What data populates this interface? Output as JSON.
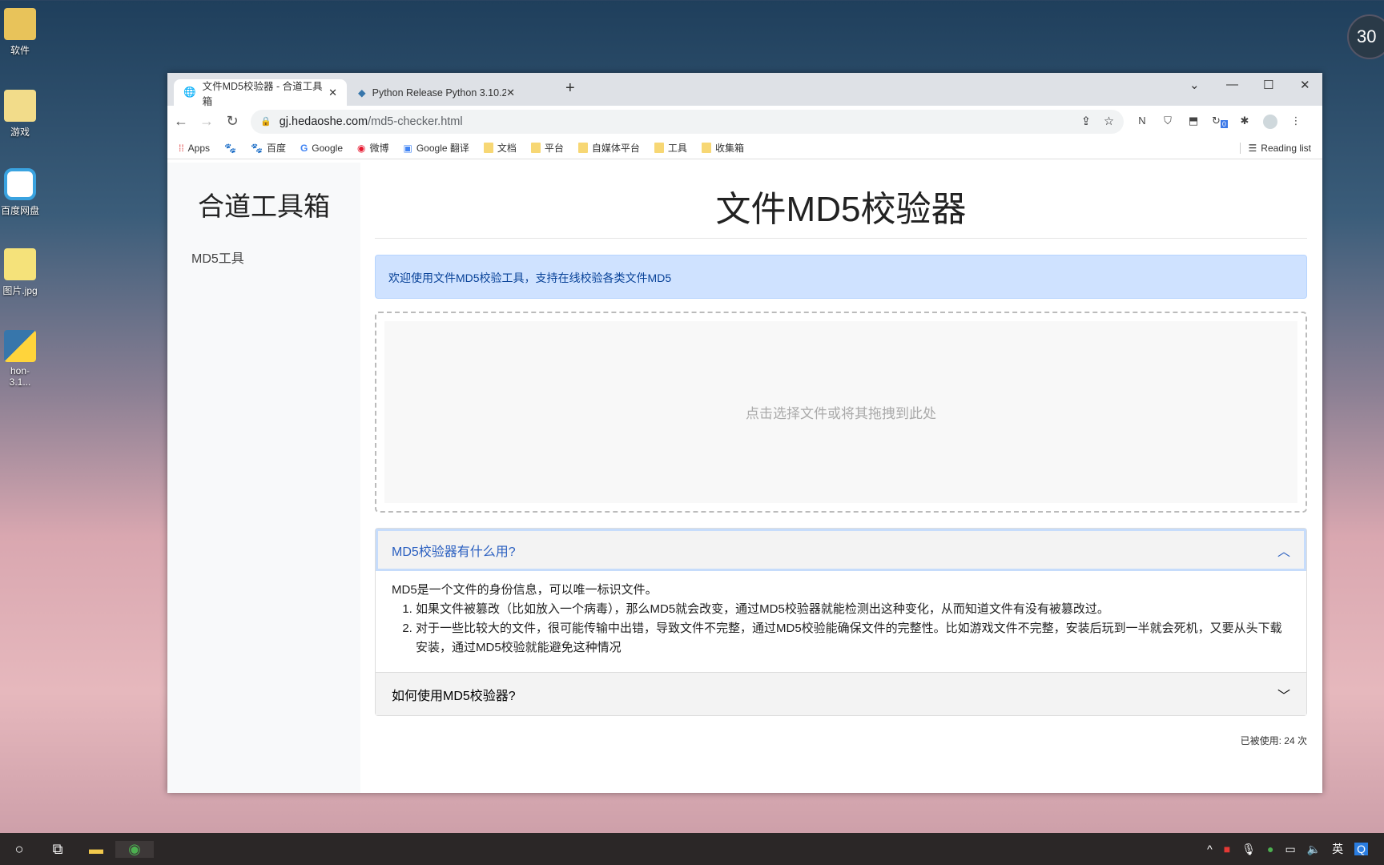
{
  "desktop": {
    "icons": [
      {
        "label": "软件"
      },
      {
        "label": "游戏"
      },
      {
        "label": "百度网盘"
      },
      {
        "label": "图片.jpg"
      },
      {
        "label": "hon-3.1..."
      }
    ],
    "clock_badge": "30"
  },
  "browser": {
    "tabs": [
      {
        "title": "文件MD5校验器 - 合道工具箱",
        "icon": "globe-icon"
      },
      {
        "title": "Python Release Python 3.10.2",
        "icon": "python-icon"
      }
    ],
    "url_host": "gj.hedaoshe.com",
    "url_path": "/md5-checker.html",
    "bookmarks": [
      {
        "label": "Apps",
        "icon": "apps-grid-icon"
      },
      {
        "label": "",
        "icon": "baidu-paw-icon"
      },
      {
        "label": "百度",
        "icon": "baidu-paw-icon"
      },
      {
        "label": "Google",
        "icon": "google-icon"
      },
      {
        "label": "微博",
        "icon": "weibo-icon"
      },
      {
        "label": "Google 翻译",
        "icon": "translate-icon"
      },
      {
        "label": "文档",
        "icon": "folder-icon"
      },
      {
        "label": "平台",
        "icon": "folder-icon"
      },
      {
        "label": "自媒体平台",
        "icon": "folder-icon"
      },
      {
        "label": "工具",
        "icon": "folder-icon"
      },
      {
        "label": "收集箱",
        "icon": "folder-icon"
      }
    ],
    "reading_list": "Reading list",
    "ext_badge": "0"
  },
  "page": {
    "brand": "合道工具箱",
    "nav": [
      "MD5工具"
    ],
    "title": "文件MD5校验器",
    "alert": "欢迎使用文件MD5校验工具，支持在线校验各类文件MD5",
    "dropzone": "点击选择文件或将其拖拽到此处",
    "faq": [
      {
        "q": "MD5校验器有什么用?",
        "expanded": true,
        "intro": "MD5是一个文件的身份信息，可以唯一标识文件。",
        "items": [
          "如果文件被篡改（比如放入一个病毒），那么MD5就会改变，通过MD5校验器就能检测出这种变化，从而知道文件有没有被篡改过。",
          "对于一些比较大的文件，很可能传输中出错，导致文件不完整，通过MD5校验能确保文件的完整性。比如游戏文件不完整，安装后玩到一半就会死机，又要从头下载安装，通过MD5校验就能避免这种情况"
        ]
      },
      {
        "q": "如何使用MD5校验器?",
        "expanded": false
      }
    ],
    "usage": "已被使用: 24 次"
  },
  "taskbar": {
    "ime": "英"
  }
}
